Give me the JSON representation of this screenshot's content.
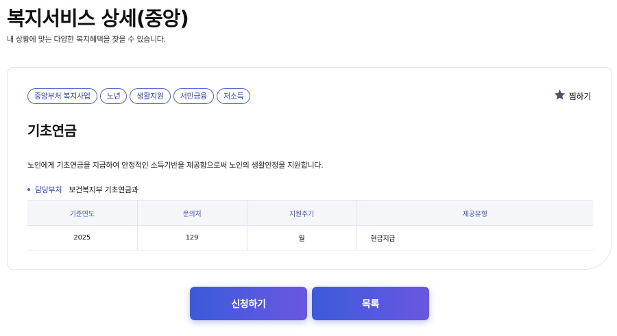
{
  "header": {
    "title": "복지서비스 상세(중앙)",
    "subtitle": "내 상황에 맞는 다양한 복지혜택을 찾을 수 있습니다."
  },
  "service": {
    "tags": [
      "중앙부처 복지사업",
      "노년",
      "생활지원",
      "서민금융",
      "저소득"
    ],
    "favorite_label": "찜하기",
    "name": "기초연금",
    "description": "노인에게 기초연금을 지급하여 안정적인 소득기반을 제공함으로써 노인의 생활안정을 지원합니다.",
    "department_label": "담당부처",
    "department_value": "보건복지부 기초연금과"
  },
  "info_table": {
    "headers": [
      "기준연도",
      "문의처",
      "지원주기",
      "제공유형"
    ],
    "row": [
      "2025",
      "129",
      "월",
      "현금지급"
    ]
  },
  "actions": {
    "apply_label": "신청하기",
    "list_label": "목록"
  },
  "colors": {
    "accent": "#4a63d1",
    "button_gradient_start": "#3b5bdb",
    "button_gradient_end": "#6a57e0",
    "star": "#4b5066"
  },
  "icons": {
    "favorite": "star-icon"
  }
}
